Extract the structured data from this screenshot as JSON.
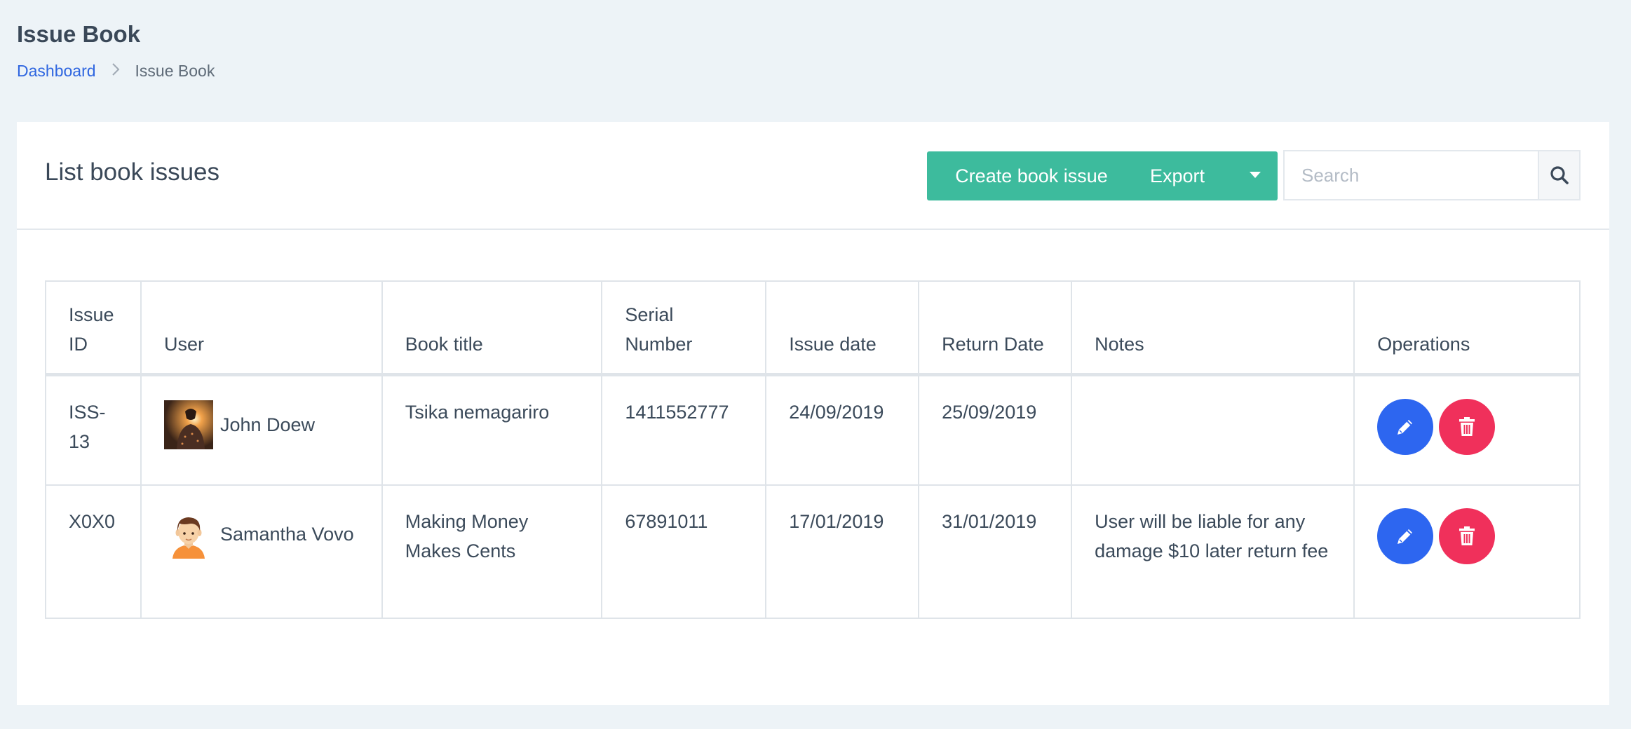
{
  "page": {
    "title": "Issue Book",
    "breadcrumb": [
      {
        "label": "Dashboard"
      },
      {
        "label": "Issue Book"
      }
    ]
  },
  "card": {
    "title": "List book issues",
    "create_button": "Create book issue",
    "export_button": "Export",
    "search": {
      "placeholder": "Search",
      "value": ""
    }
  },
  "table": {
    "columns": [
      "Issue ID",
      "User",
      "Book title",
      "Serial Number",
      "Issue date",
      "Return Date",
      "Notes",
      "Operations"
    ],
    "rows": [
      {
        "issue_id": "ISS-13",
        "user": "John Doew",
        "book_title": "Tsika nemagariro",
        "serial_number": "1411552777",
        "issue_date": "24/09/2019",
        "return_date": "25/09/2019",
        "notes": ""
      },
      {
        "issue_id": "X0X0",
        "user": "Samantha Vovo",
        "book_title": "Making Money Makes Cents",
        "serial_number": "67891011",
        "issue_date": "17/01/2019",
        "return_date": "31/01/2019",
        "notes": "User will be liable for any damage $10 later return fee"
      }
    ]
  },
  "icons": {
    "search": "search-icon",
    "edit": "pencil-icon",
    "delete": "trash-icon",
    "dropdown": "caret-down-icon",
    "separator": "chevron-right-icon"
  },
  "colors": {
    "accent": "#3dbb9d",
    "edit": "#2d66f0",
    "delete": "#f0305b",
    "link": "#2f66e0"
  }
}
